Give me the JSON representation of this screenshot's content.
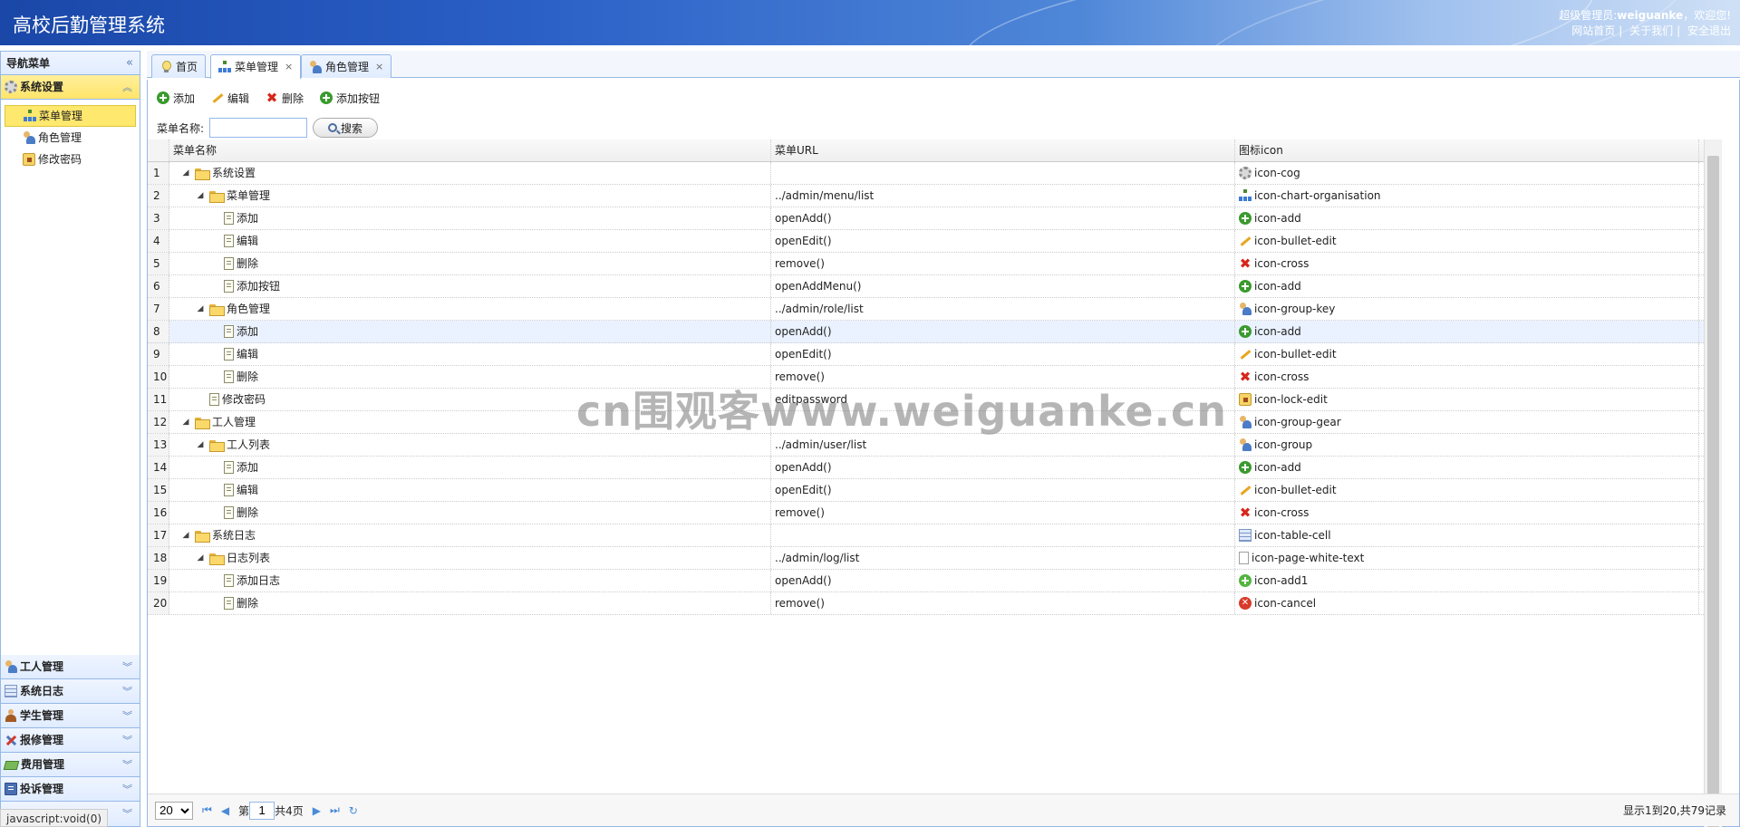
{
  "header": {
    "title": "高校后勤管理系统",
    "user_prefix": "超级管理员:",
    "username": "weiguanke",
    "welcome": "，欢迎您!",
    "links": [
      "网站首页",
      "关于我们",
      "安全退出"
    ]
  },
  "sidebar": {
    "title": "导航菜单",
    "open_section": {
      "label": "系统设置",
      "icon": "gear-icon"
    },
    "items": [
      {
        "label": "菜单管理",
        "icon": "org-chart-icon",
        "selected": true
      },
      {
        "label": "角色管理",
        "icon": "group-key-icon",
        "selected": false
      },
      {
        "label": "修改密码",
        "icon": "lock-edit-icon",
        "selected": false
      }
    ],
    "sections": [
      {
        "label": "工人管理",
        "icon": "group-icon"
      },
      {
        "label": "系统日志",
        "icon": "table-icon"
      },
      {
        "label": "学生管理",
        "icon": "person-icon"
      },
      {
        "label": "报修管理",
        "icon": "wrench-icon"
      },
      {
        "label": "费用管理",
        "icon": "money-icon"
      },
      {
        "label": "投诉管理",
        "icon": "book-icon"
      }
    ]
  },
  "tabs": [
    {
      "label": "首页",
      "icon": "bulb-icon",
      "closable": false
    },
    {
      "label": "菜单管理",
      "icon": "org-chart-icon",
      "closable": true,
      "active": true
    },
    {
      "label": "角色管理",
      "icon": "group-key-icon",
      "closable": true
    }
  ],
  "toolbar": {
    "add": "添加",
    "edit": "编辑",
    "delete": "删除",
    "add_button": "添加按钮"
  },
  "search": {
    "label": "菜单名称:",
    "value": "",
    "button": "搜索"
  },
  "grid": {
    "columns": [
      "菜单名称",
      "菜单URL",
      "图标icon"
    ],
    "rows": [
      {
        "n": "1",
        "name": "系统设置",
        "level": 0,
        "type": "folder",
        "url": "",
        "icon": "icon-cog"
      },
      {
        "n": "2",
        "name": "菜单管理",
        "level": 1,
        "type": "folder",
        "url": "../admin/menu/list",
        "icon": "icon-chart-organisation"
      },
      {
        "n": "3",
        "name": "添加",
        "level": 2,
        "type": "file",
        "url": "openAdd()",
        "icon": "icon-add"
      },
      {
        "n": "4",
        "name": "编辑",
        "level": 2,
        "type": "file",
        "url": "openEdit()",
        "icon": "icon-bullet-edit"
      },
      {
        "n": "5",
        "name": "删除",
        "level": 2,
        "type": "file",
        "url": "remove()",
        "icon": "icon-cross"
      },
      {
        "n": "6",
        "name": "添加按钮",
        "level": 2,
        "type": "file",
        "url": "openAddMenu()",
        "icon": "icon-add"
      },
      {
        "n": "7",
        "name": "角色管理",
        "level": 1,
        "type": "folder",
        "url": "../admin/role/list",
        "icon": "icon-group-key"
      },
      {
        "n": "8",
        "name": "添加",
        "level": 2,
        "type": "file",
        "url": "openAdd()",
        "icon": "icon-add"
      },
      {
        "n": "9",
        "name": "编辑",
        "level": 2,
        "type": "file",
        "url": "openEdit()",
        "icon": "icon-bullet-edit"
      },
      {
        "n": "10",
        "name": "删除",
        "level": 2,
        "type": "file",
        "url": "remove()",
        "icon": "icon-cross"
      },
      {
        "n": "11",
        "name": "修改密码",
        "level": 1,
        "type": "file",
        "url": "editpassword",
        "icon": "icon-lock-edit"
      },
      {
        "n": "12",
        "name": "工人管理",
        "level": 0,
        "type": "folder",
        "url": "",
        "icon": "icon-group-gear"
      },
      {
        "n": "13",
        "name": "工人列表",
        "level": 1,
        "type": "folder",
        "url": "../admin/user/list",
        "icon": "icon-group"
      },
      {
        "n": "14",
        "name": "添加",
        "level": 2,
        "type": "file",
        "url": "openAdd()",
        "icon": "icon-add"
      },
      {
        "n": "15",
        "name": "编辑",
        "level": 2,
        "type": "file",
        "url": "openEdit()",
        "icon": "icon-bullet-edit"
      },
      {
        "n": "16",
        "name": "删除",
        "level": 2,
        "type": "file",
        "url": "remove()",
        "icon": "icon-cross"
      },
      {
        "n": "17",
        "name": "系统日志",
        "level": 0,
        "type": "folder",
        "url": "",
        "icon": "icon-table-cell"
      },
      {
        "n": "18",
        "name": "日志列表",
        "level": 1,
        "type": "folder",
        "url": "../admin/log/list",
        "icon": "icon-page-white-text"
      },
      {
        "n": "19",
        "name": "添加日志",
        "level": 2,
        "type": "file",
        "url": "openAdd()",
        "icon": "icon-add1"
      },
      {
        "n": "20",
        "name": "删除",
        "level": 2,
        "type": "file",
        "url": "remove()",
        "icon": "icon-cancel"
      }
    ],
    "hover_row": 8
  },
  "pager": {
    "page_size": "20",
    "page_prefix": "第",
    "page_num": "1",
    "total_pages": "共4页",
    "info": "显示1到20,共79记录"
  },
  "status_link": "javascript:void(0)",
  "watermark": "cn围观客www.weiguanke.cn"
}
